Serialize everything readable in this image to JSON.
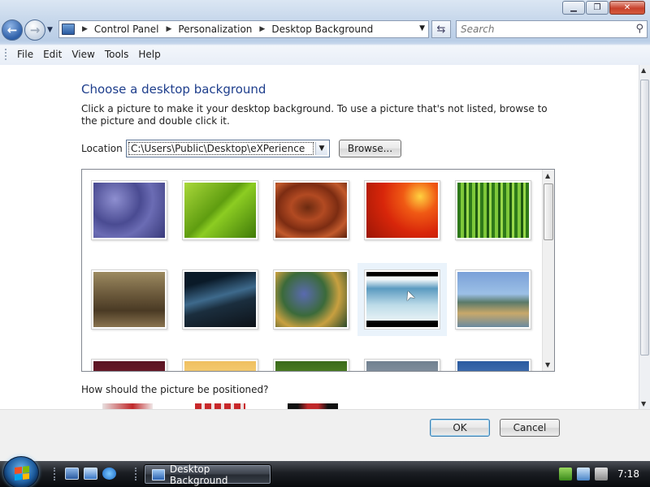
{
  "window": {
    "min_label": "▁",
    "max_label": "❐",
    "close_label": "✕"
  },
  "address": {
    "crumbs": [
      "Control Panel",
      "Personalization",
      "Desktop Background"
    ]
  },
  "search": {
    "placeholder": "Search"
  },
  "menu": [
    "File",
    "Edit",
    "View",
    "Tools",
    "Help"
  ],
  "content": {
    "heading": "Choose a desktop background",
    "description": "Click a picture to make it your desktop background. To use a picture that's not listed, browse to the picture and double click it.",
    "location_label": "Location",
    "location_value": "C:\\Users\\Public\\Desktop\\eXPerience",
    "browse_label": "Browse...",
    "position_question": "How should the picture be positioned?"
  },
  "gallery": {
    "selected_index": 8,
    "tiles": [
      {
        "name": "blue-pebbles",
        "gradient": "radial-gradient(circle at 30% 30%, #8e8fd0, #4a4b92 40%, #6b6cb4 60%, #38397a)"
      },
      {
        "name": "green-leaf",
        "gradient": "linear-gradient(135deg, #a9d83a, #5f9d10 45%, #8ccc22 55%, #3f7a08)"
      },
      {
        "name": "wood-grain",
        "gradient": "radial-gradient(ellipse at 45% 45%, #6b2a10, #b24a22 30%, #7c2c12 55%, #c25a2c 75%, #5a200c)"
      },
      {
        "name": "red-flower",
        "gradient": "radial-gradient(circle at 75% 25%, #ffd240, #f05a14 25%, #d8260a 55%, #9c1606)"
      },
      {
        "name": "bamboo-forest",
        "gradient": "repeating-linear-gradient(90deg, #2f7a1a 0 4px, #7ec83a 4px 8px, #1f5a12 8px 11px, #98d84a 11px 14px)"
      },
      {
        "name": "seurat-painting",
        "gradient": "linear-gradient(180deg, #9c8a60, #6c5a3c 40%, #4a3a24 70%, #8a7450)"
      },
      {
        "name": "bridge-night",
        "gradient": "linear-gradient(165deg, #0a1a28 20%, #3e6a8c 45%, #1b2e3e 60%, #0d1218)"
      },
      {
        "name": "irises",
        "gradient": "radial-gradient(circle at 40% 40%, #5a6ab0, #3b6a3a 40%, #c8a040 65%, #2a4a2a)"
      },
      {
        "name": "koi-fish",
        "gradient": "linear-gradient(180deg, #000 0 8%, #f0f6f8 8% 14%, #5a9ac0 30%, #bcdbe8 60%, #e8f2f6 88%, #000 88%)"
      },
      {
        "name": "river-mountains",
        "gradient": "linear-gradient(180deg, #7aa0d8, #9cc0e6 40%, #5a7a6a 55%, #c8a86a 75%, #6a8aa0)"
      },
      {
        "name": "row3-tile-1",
        "gradient": "linear-gradient(180deg, #5a1422, #9a2a3a)"
      },
      {
        "name": "row3-tile-2",
        "gradient": "linear-gradient(180deg, #f0c060, #fff0b0)"
      },
      {
        "name": "row3-tile-3",
        "gradient": "linear-gradient(180deg, #3a6a1a, #8ac040)"
      },
      {
        "name": "row3-tile-4",
        "gradient": "linear-gradient(180deg, #708090, #c0c8d0)"
      },
      {
        "name": "row3-tile-5",
        "gradient": "linear-gradient(180deg, #2a5aa0, #8ab0e0)"
      }
    ]
  },
  "buttons": {
    "ok": "OK",
    "cancel": "Cancel"
  },
  "taskbar": {
    "task_label": "Desktop Background",
    "clock": "7:18"
  }
}
